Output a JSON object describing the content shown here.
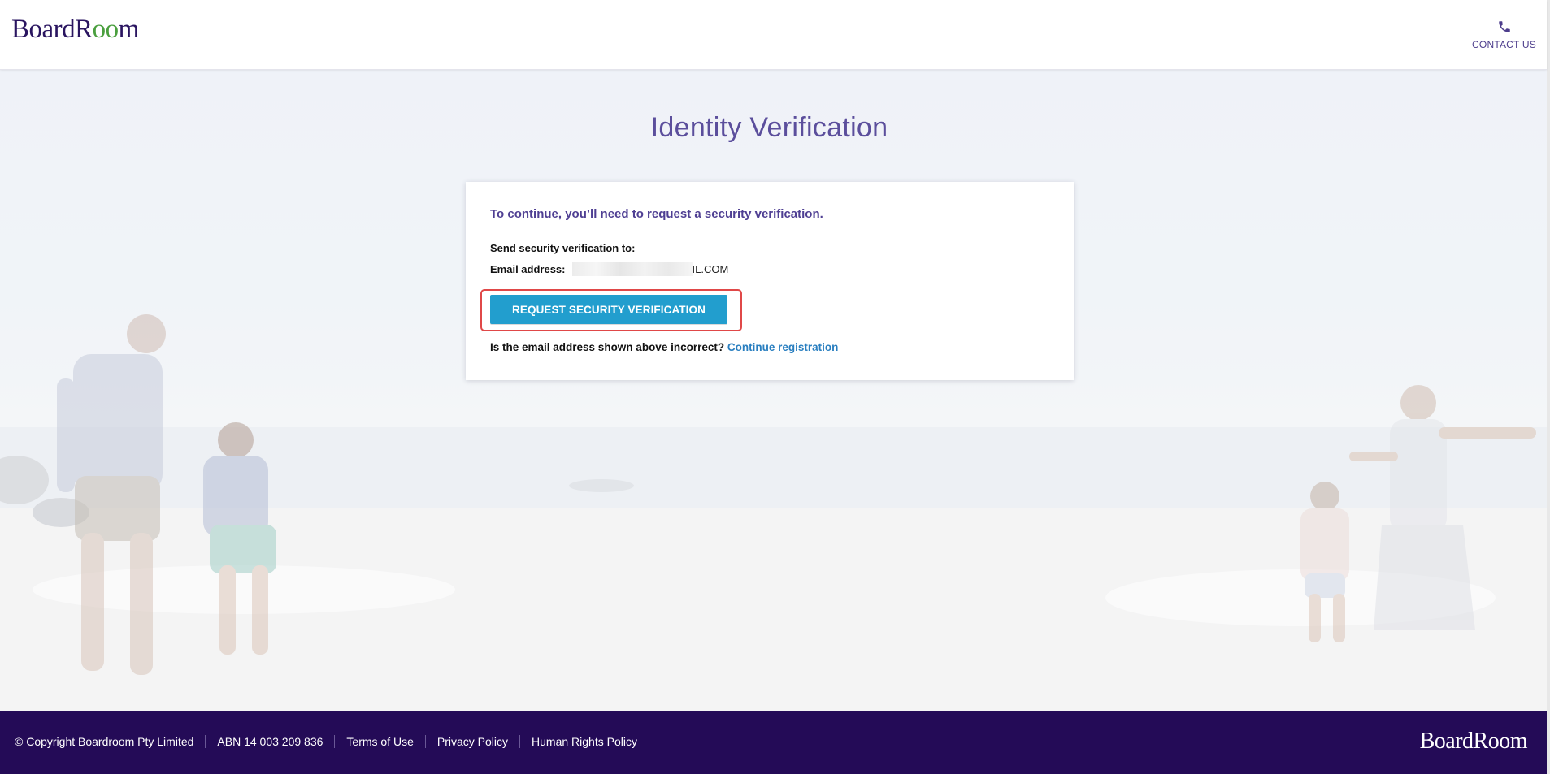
{
  "header": {
    "logo": {
      "part1": "BoardR",
      "part2": "oo",
      "part3": "m"
    },
    "contact_label": "CONTACT US"
  },
  "main": {
    "title": "Identity Verification",
    "card": {
      "heading": "To continue, you’ll need to request a security verification.",
      "send_to_label": "Send security verification to:",
      "email_label": "Email address:",
      "email_value_visible": "IL.COM",
      "button_label": "REQUEST SECURITY VERIFICATION",
      "incorrect_question": "Is the email address shown above incorrect?",
      "continue_link": "Continue registration"
    }
  },
  "footer": {
    "items": [
      {
        "label": "© Copyright Boardroom Pty Limited"
      },
      {
        "label": "ABN 14 003 209 836"
      },
      {
        "label": "Terms of Use"
      },
      {
        "label": "Privacy Policy"
      },
      {
        "label": "Human Rights Policy"
      }
    ],
    "logo": "BoardRoom"
  },
  "colors": {
    "brand_purple": "#240b57",
    "button_blue": "#229ece",
    "highlight_red": "#e04848",
    "link_blue": "#2a7fc0",
    "logo_green": "#4a9f3e"
  },
  "icons": {
    "contact": "phone-icon"
  }
}
